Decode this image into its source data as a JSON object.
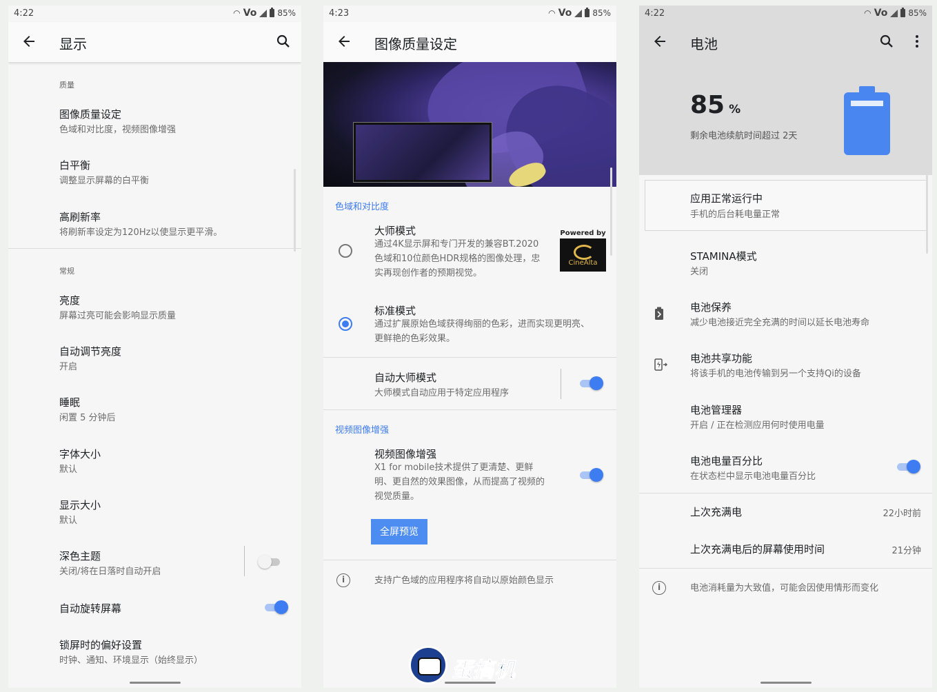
{
  "phone1": {
    "status": {
      "time": "4:22",
      "volte": "Vo",
      "battery": "85%"
    },
    "title": "显示",
    "section_quality": "质量",
    "items_quality": [
      {
        "title": "图像质量设定",
        "sub": "色域和对比度，视频图像增强"
      },
      {
        "title": "白平衡",
        "sub": "调整显示屏幕的白平衡"
      },
      {
        "title": "高刷新率",
        "sub": "将刷新率设定为120Hz以使显示更平滑。"
      }
    ],
    "section_general": "常规",
    "items_general": [
      {
        "title": "亮度",
        "sub": "屏幕过亮可能会影响显示质量"
      },
      {
        "title": "自动调节亮度",
        "sub": "开启"
      },
      {
        "title": "睡眠",
        "sub": "闲置 5 分钟后"
      },
      {
        "title": "字体大小",
        "sub": "默认"
      },
      {
        "title": "显示大小",
        "sub": "默认"
      },
      {
        "title": "深色主题",
        "sub": "关闭/将在日落时自动开启"
      }
    ],
    "auto_rotate": "自动旋转屏幕",
    "lock_pref": {
      "title": "锁屏时的偏好设置",
      "sub": "时钟、通知、环境显示（始终显示）"
    }
  },
  "phone2": {
    "status": {
      "time": "4:23",
      "volte": "Vo",
      "battery": "85%"
    },
    "title": "图像质量设定",
    "section_color": "色域和对比度",
    "master": {
      "title": "大师模式",
      "desc": "通过4K显示屏和专门开发的兼容BT.2020色域和10位颜色HDR规格的图像处理，忠实再现创作者的预期视觉。",
      "powered": "Powered by",
      "brand": "CineAlta"
    },
    "standard": {
      "title": "标准模式",
      "desc": "通过扩展原始色域获得绚丽的色彩，进而实现更明亮、更鲜艳的色彩效果。"
    },
    "auto_master": {
      "title": "自动大师模式",
      "sub": "大师模式自动应用于特定应用程序"
    },
    "section_video": "视频图像增强",
    "video": {
      "title": "视频图像增强",
      "desc": "X1 for mobile技术提供了更清楚、更鲜明、更自然的效果图像，从而提高了视频的视觉质量。"
    },
    "preview_btn": "全屏预览",
    "info": "支持广色域的应用程序将自动以原始颜色显示"
  },
  "phone3": {
    "status": {
      "time": "4:22",
      "volte": "Vo",
      "battery": "85%"
    },
    "title": "电池",
    "level": "85",
    "level_unit": "%",
    "remain": "剩余电池续航时间超过 2天",
    "battery_fill": 0.85,
    "card": {
      "title": "应用正常运行中",
      "sub": "手机的后台耗电量正常"
    },
    "items": [
      {
        "title": "STAMINA模式",
        "sub": "关闭"
      },
      {
        "title": "电池保养",
        "sub": "减少电池接近完全充满的时间以延长电池寿命"
      },
      {
        "title": "电池共享功能",
        "sub": "将该手机的电池传输到另一个支持Qi的设备"
      },
      {
        "title": "电池管理器",
        "sub": "开启 / 正在检测应用何时使用电量"
      },
      {
        "title": "电池电量百分比",
        "sub": "在状态栏中显示电池电量百分比"
      }
    ],
    "last_full": {
      "label": "上次充满电",
      "value": "22小时前"
    },
    "screen_time": {
      "label": "上次充满电后的屏幕使用时间",
      "value": "21分钟"
    },
    "info": "电池消耗量为大致值，可能会因使用情形而变化"
  },
  "watermark": "蛋搞机"
}
